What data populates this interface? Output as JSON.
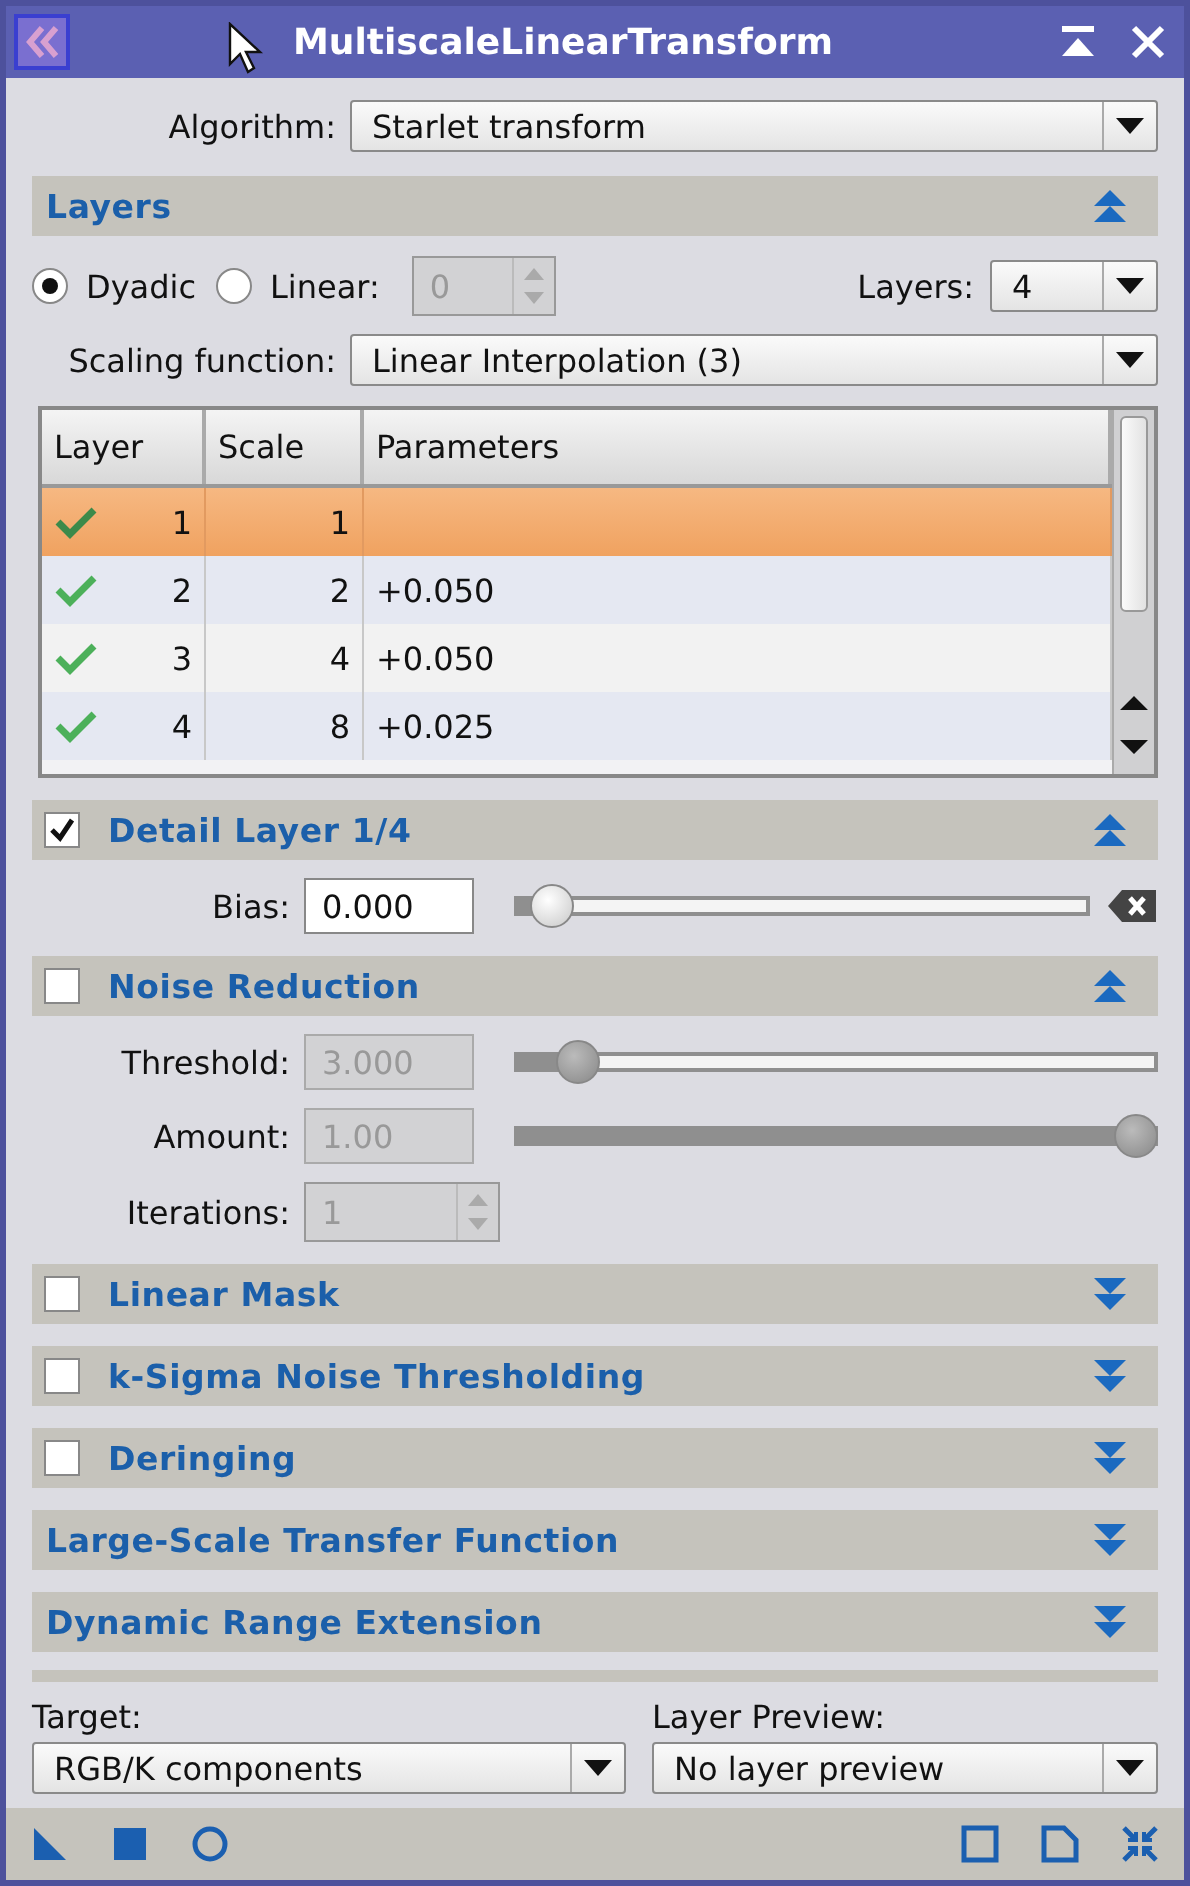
{
  "window": {
    "title": "MultiscaleLinearTransform"
  },
  "algorithm": {
    "label": "Algorithm:",
    "value": "Starlet transform"
  },
  "sections": [
    {
      "title": "Layers",
      "expanded": true,
      "controls": [
        {
          "kind": "radio_row",
          "options": [
            {
              "label": "Dyadic",
              "selected": true
            },
            {
              "label": "Linear:",
              "selected": false
            }
          ],
          "spin": {
            "value": "0",
            "disabled": true
          },
          "layers": {
            "label": "Layers:",
            "value": "4"
          }
        },
        {
          "kind": "combo",
          "label": "Scaling function:",
          "value": "Linear Interpolation (3)"
        },
        {
          "kind": "table",
          "columns": [
            "Layer",
            "Scale",
            "Parameters"
          ],
          "rows": [
            {
              "enabled": true,
              "selected": true,
              "layer": "1",
              "scale": "1"
            },
            {
              "enabled": true,
              "selected": false,
              "layer": "2",
              "scale": "2",
              "parameters": "+0.050"
            },
            {
              "enabled": true,
              "selected": false,
              "layer": "3",
              "scale": "4",
              "parameters": "+0.050"
            },
            {
              "enabled": true,
              "selected": false,
              "layer": "4",
              "scale": "8",
              "parameters": "+0.025"
            }
          ]
        }
      ]
    },
    {
      "title": "Detail Layer 1/4",
      "checked": true,
      "expanded": true,
      "controls": [
        {
          "kind": "slider",
          "label": "Bias:",
          "value": "0.000",
          "level": 0.03,
          "disabled": false,
          "clear_button": true
        }
      ]
    },
    {
      "title": "Noise Reduction",
      "checked": false,
      "expanded": true,
      "controls": [
        {
          "kind": "slider",
          "label": "Threshold:",
          "value": "3.000",
          "level": 0.07,
          "disabled": true
        },
        {
          "kind": "slider",
          "label": "Amount:",
          "value": "1.00",
          "level": 1.0,
          "disabled": true
        },
        {
          "kind": "spin",
          "label": "Iterations:",
          "value": "1",
          "disabled": true
        }
      ]
    },
    {
      "title": "Linear Mask",
      "checked": false,
      "expanded": false
    },
    {
      "title": "k-Sigma Noise Thresholding",
      "checked": false,
      "expanded": false
    },
    {
      "title": "Deringing",
      "checked": false,
      "expanded": false
    },
    {
      "title": "Large-Scale Transfer Function",
      "expanded": false
    },
    {
      "title": "Dynamic Range Extension",
      "expanded": false
    }
  ],
  "target": {
    "label": "Target:",
    "value": "RGB/K components"
  },
  "layer_preview": {
    "label": "Layer Preview:",
    "value": "No layer preview"
  }
}
